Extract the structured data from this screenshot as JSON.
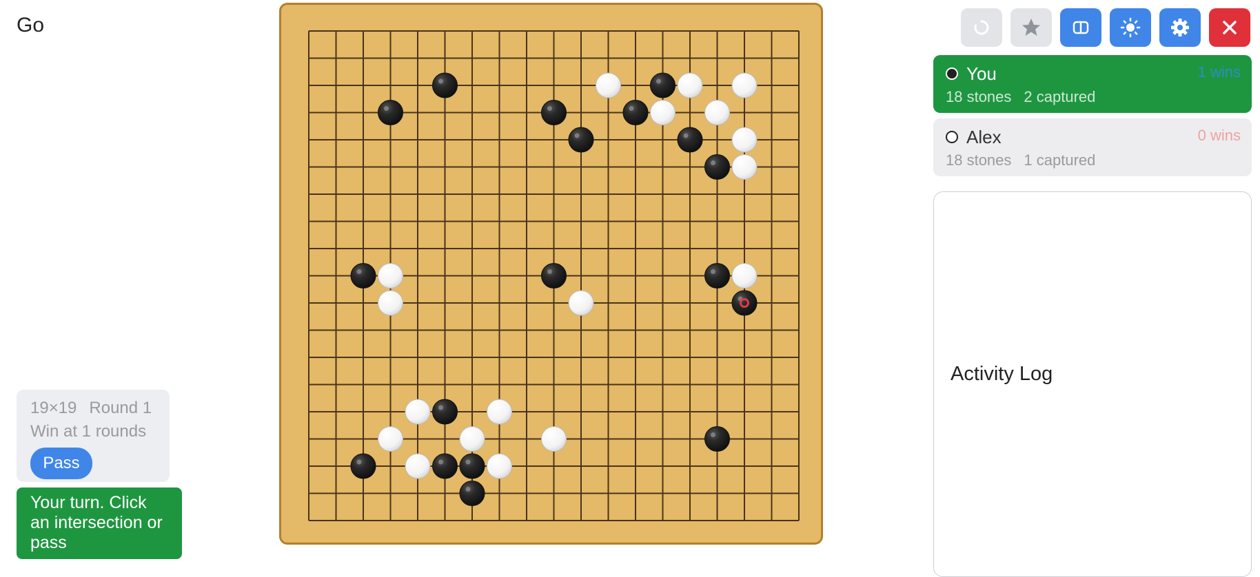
{
  "app": {
    "title": "Go"
  },
  "toolbar": {
    "buttons": [
      {
        "name": "undo-icon",
        "style": "gray"
      },
      {
        "name": "star-icon",
        "style": "gray"
      },
      {
        "name": "layout-icon",
        "style": "blue"
      },
      {
        "name": "sun-icon",
        "style": "blue"
      },
      {
        "name": "gear-icon",
        "style": "blue"
      },
      {
        "name": "close-icon",
        "style": "red"
      }
    ]
  },
  "players": [
    {
      "name": "You",
      "stones": "18 stones",
      "captured": "2 captured",
      "wins": "1 wins",
      "stone_color": "black",
      "active": true
    },
    {
      "name": "Alex",
      "stones": "18 stones",
      "captured": "1 captured",
      "wins": "0 wins",
      "stone_color": "white",
      "active": false
    }
  ],
  "log": {
    "title": "Activity Log"
  },
  "info": {
    "board_size": "19×19",
    "round": "Round 1",
    "win_condition": "Win at 1 rounds",
    "pass_label": "Pass"
  },
  "status": {
    "message": "Your turn. Click an intersection or pass"
  },
  "game": {
    "size": 19,
    "black": [
      [
        5,
        2
      ],
      [
        3,
        3
      ],
      [
        9,
        3
      ],
      [
        13,
        2
      ],
      [
        12,
        3
      ],
      [
        10,
        4
      ],
      [
        14,
        4
      ],
      [
        15,
        5
      ],
      [
        2,
        9
      ],
      [
        9,
        9
      ],
      [
        15,
        9
      ],
      [
        16,
        10
      ],
      [
        5,
        14
      ],
      [
        2,
        16
      ],
      [
        5,
        16
      ],
      [
        6,
        16
      ],
      [
        6,
        17
      ],
      [
        15,
        15
      ]
    ],
    "white": [
      [
        11,
        2
      ],
      [
        14,
        2
      ],
      [
        16,
        2
      ],
      [
        13,
        3
      ],
      [
        15,
        3
      ],
      [
        16,
        4
      ],
      [
        16,
        5
      ],
      [
        3,
        9
      ],
      [
        16,
        9
      ],
      [
        3,
        10
      ],
      [
        10,
        10
      ],
      [
        4,
        14
      ],
      [
        7,
        14
      ],
      [
        3,
        15
      ],
      [
        6,
        15
      ],
      [
        9,
        15
      ],
      [
        4,
        16
      ],
      [
        7,
        16
      ]
    ],
    "last_move": [
      16,
      10
    ]
  },
  "colors": {
    "board": "#e4b967",
    "board_border": "#b47f2a",
    "grid": "#4a3418",
    "active_green": "#1e9640",
    "accent_blue": "#3f86e8",
    "close_red": "#e0303a",
    "last_move_marker": "#e03a4a"
  }
}
